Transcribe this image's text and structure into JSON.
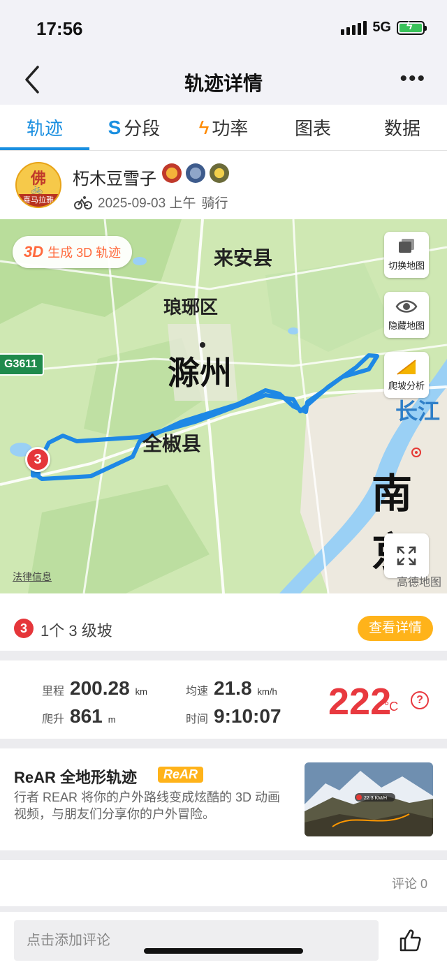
{
  "status": {
    "time": "17:56",
    "network": "5G"
  },
  "nav": {
    "title": "轨迹详情"
  },
  "tabs": [
    {
      "label": "轨迹",
      "icon": ""
    },
    {
      "label": "分段",
      "icon": "segment-icon"
    },
    {
      "label": "功率",
      "icon": "lightning-icon"
    },
    {
      "label": "图表",
      "icon": ""
    },
    {
      "label": "数据",
      "icon": ""
    }
  ],
  "user": {
    "name": "朽木豆雪子",
    "avatar_char": "佛",
    "avatar_ribbon": "喜马拉雅",
    "datetime": "2025-09-03 上午",
    "activity": "骑行"
  },
  "map": {
    "btn_3d_prefix": "3D",
    "btn_3d_label": "生成 3D 轨迹",
    "switch_label": "切换地图",
    "hide_label": "隐藏地图",
    "climb_label": "爬坡分析",
    "legal": "法律信息",
    "provider": "高德地图",
    "places": {
      "laian": "来安县",
      "langya": "琅琊区",
      "chuzhou": "滁州",
      "quanjiao": "全椒县",
      "nanjing": "南京",
      "changjiang": "长江",
      "road": "G3611"
    },
    "climb_marker": "3",
    "colors": {
      "track": "#1e88e5",
      "land": "#cfe8b3",
      "water": "#9ad0f5"
    }
  },
  "climb": {
    "level": "3",
    "text": "1个 3 级坡",
    "detail_button": "查看详情"
  },
  "stats": {
    "distance_label": "里程",
    "distance": "200.28",
    "distance_unit": "km",
    "elevation_label": "爬升",
    "elevation": "861",
    "elevation_unit": "m",
    "speed_label": "均速",
    "speed": "21.8",
    "speed_unit": "km/h",
    "time_label": "时间",
    "time": "9:10:07",
    "temperature": "222",
    "temperature_unit": "°C",
    "help": "?"
  },
  "rear": {
    "title": "ReAR 全地形轨迹",
    "tag": "ReAR",
    "description": "行者 REAR 将你的户外路线变成炫酷的 3D 动画视频，与朋友们分享你的户外冒险。",
    "thumb_speed": "22.3 KM/H"
  },
  "comments": {
    "count_label": "评论 0",
    "input_placeholder": "点击添加评论"
  }
}
